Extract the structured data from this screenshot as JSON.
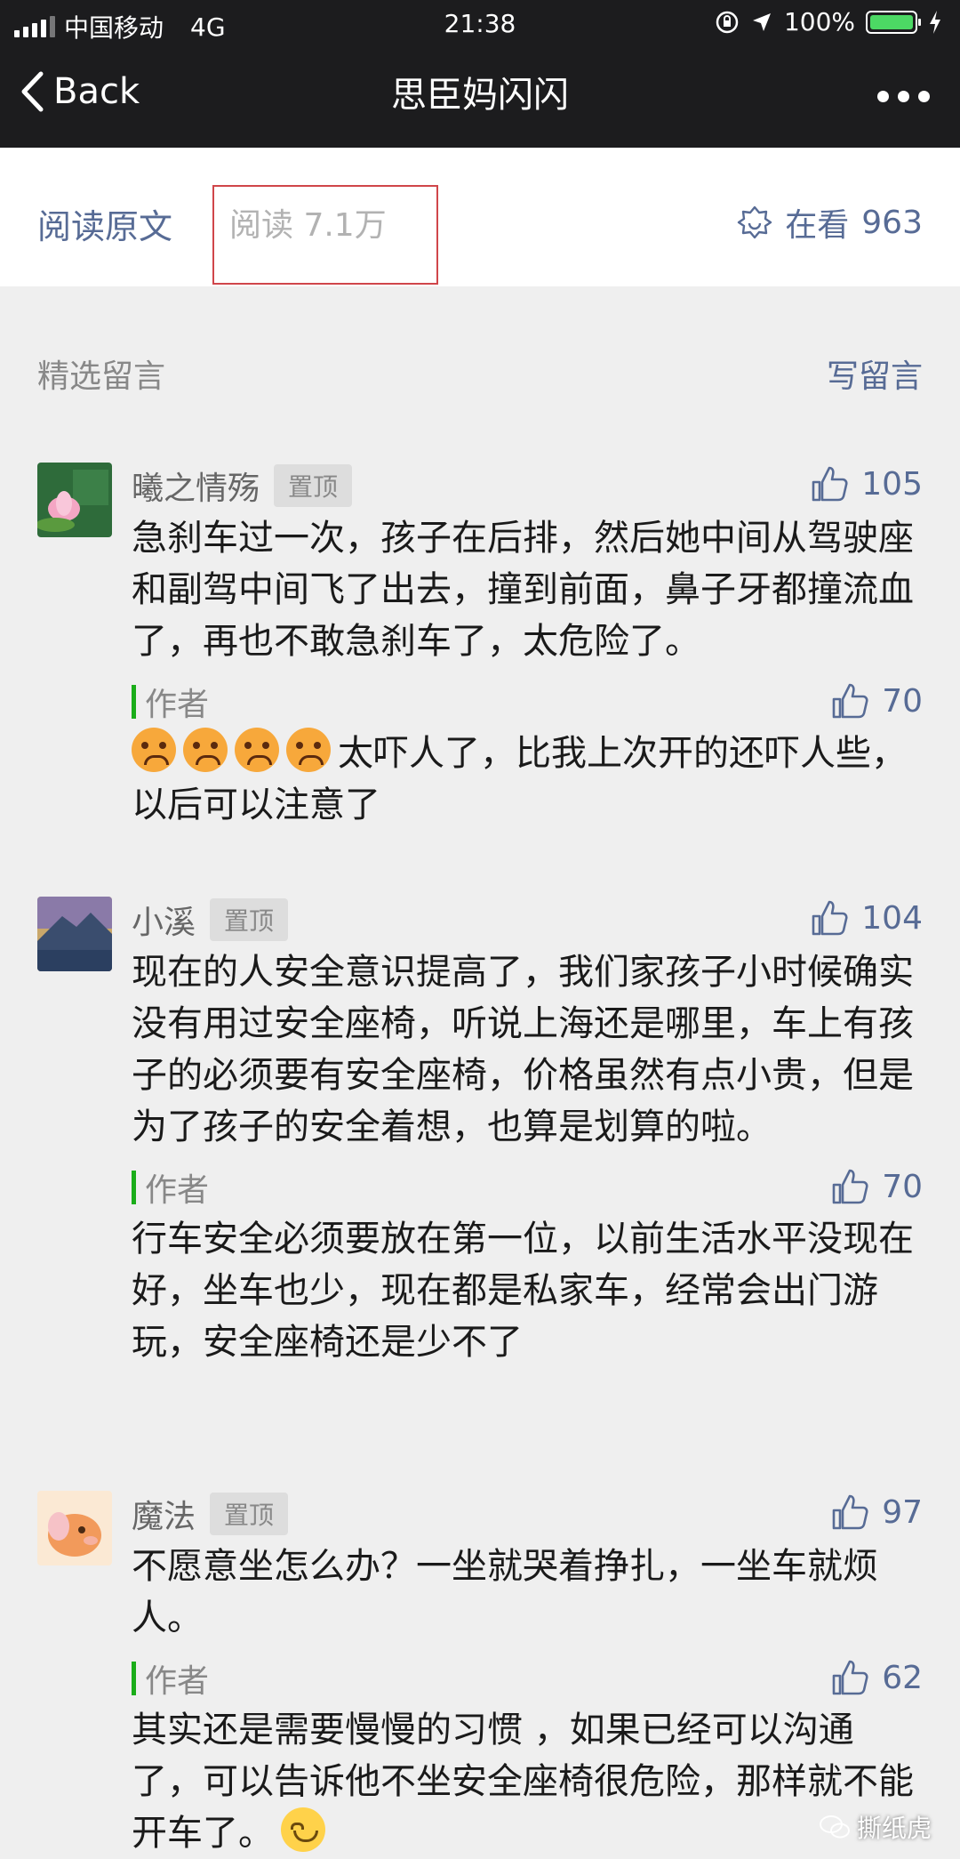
{
  "status_bar": {
    "carrier": "中国移动",
    "network": "4G",
    "time": "21:38",
    "battery_percent": "100%",
    "battery_level": 1.0,
    "battery_color": "#4cd964"
  },
  "nav": {
    "back_label": "Back",
    "title": "思臣妈闪闪",
    "more_icon": "more-dots-icon"
  },
  "read_bar": {
    "original_label": "阅读原文",
    "reads_label": "阅读 7.1万",
    "watching_label": "在看",
    "watching_count": "963"
  },
  "comments_header": {
    "label": "精选留言",
    "write_label": "写留言"
  },
  "comments": [
    {
      "username": "曦之情殇",
      "pin_label": "置顶",
      "likes": "105",
      "text": "急刹车过一次，孩子在后排，然后她中间从驾驶座和副驾中间飞了出去，撞到前面，鼻子牙都撞流血了，再也不敢急刹车了，太危险了。",
      "reply": {
        "author_label": "作者",
        "likes": "70",
        "text": "太吓人了，比我上次开的还吓人些，以后可以注意了"
      }
    },
    {
      "username": "小溪",
      "pin_label": "置顶",
      "likes": "104",
      "text": "现在的人安全意识提高了，我们家孩子小时候确实没有用过安全座椅，听说上海还是哪里，车上有孩子的必须要有安全座椅，价格虽然有点小贵，但是为了孩子的安全着想，也算是划算的啦。",
      "reply": {
        "author_label": "作者",
        "likes": "70",
        "text": "行车安全必须要放在第一位，以前生活水平没现在好，坐车也少，现在都是私家车，经常会出门游玩，安全座椅还是少不了"
      }
    },
    {
      "username": "魔法",
      "pin_label": "置顶",
      "likes": "97",
      "text": "不愿意坐怎么办？一坐就哭着挣扎，一坐车就烦人。",
      "reply": {
        "author_label": "作者",
        "likes": "62",
        "text": "其实还是需要慢慢的习惯 ，如果已经可以沟通了，可以告诉他不坐安全座椅很危险，那样就不能开车了。"
      }
    }
  ],
  "watermark": "撕纸虎",
  "colors": {
    "link": "#576b95",
    "author_bar": "#1aad19",
    "highlight_box": "#d0464a",
    "top_bar": "#1c1c1e"
  }
}
